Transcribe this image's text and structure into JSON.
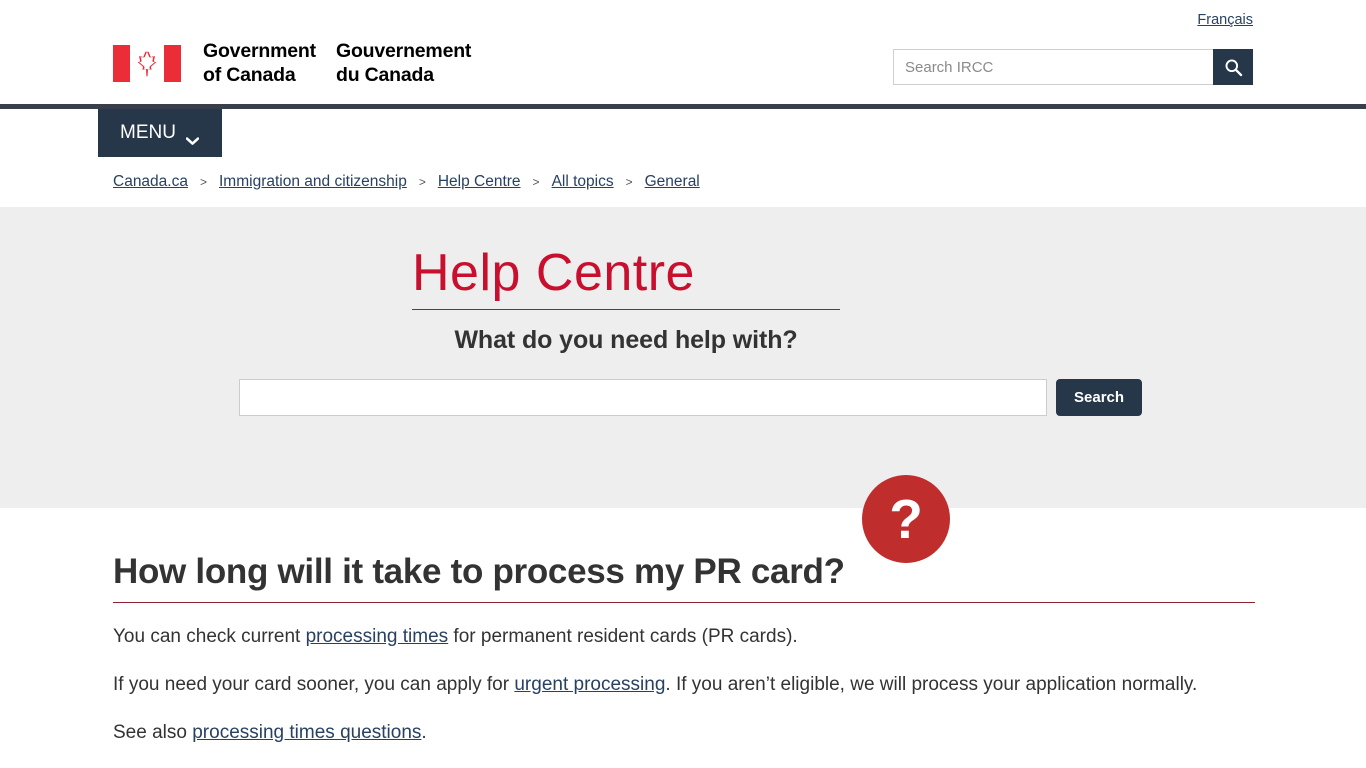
{
  "header": {
    "lang_toggle": "Français",
    "fip": {
      "en_line1": "Government",
      "en_line2": "of Canada",
      "fr_line1": "Gouvernement",
      "fr_line2": "du Canada",
      "flag_icon": "canada-flag-icon"
    },
    "search": {
      "placeholder": "Search IRCC",
      "value": "",
      "button_icon": "magnifier-icon"
    }
  },
  "menu": {
    "label": "MENU",
    "chevron_icon": "chevron-down-icon"
  },
  "breadcrumb": {
    "separator": ">",
    "items": [
      {
        "label": "Canada.ca"
      },
      {
        "label": "Immigration and citizenship"
      },
      {
        "label": "Help Centre"
      },
      {
        "label": "All topics"
      },
      {
        "label": "General"
      }
    ]
  },
  "help_centre": {
    "title": "Help Centre",
    "subtitle": "What do you need help with?",
    "question_mark": "?",
    "question_icon": "question-mark-circle-icon",
    "search": {
      "value": "",
      "placeholder": "",
      "button_label": "Search"
    }
  },
  "article": {
    "title": "How long will it take to process my PR card?",
    "paragraphs": [
      {
        "parts": [
          {
            "type": "text",
            "text": "You can check current "
          },
          {
            "type": "link",
            "text": "processing times"
          },
          {
            "type": "text",
            "text": " for permanent resident cards (PR cards)."
          }
        ]
      },
      {
        "parts": [
          {
            "type": "text",
            "text": "If you need your card sooner, you can apply for "
          },
          {
            "type": "link",
            "text": "urgent processing"
          },
          {
            "type": "text",
            "text": ". If you aren’t eligible, we will process your application normally."
          }
        ]
      },
      {
        "parts": [
          {
            "type": "text",
            "text": "See also "
          },
          {
            "type": "link",
            "text": "processing times questions"
          },
          {
            "type": "text",
            "text": "."
          }
        ]
      }
    ]
  },
  "colors": {
    "nav_dark": "#26374a",
    "header_rule": "#383e4a",
    "brand_red": "#c8102e",
    "qmark_red": "#bf2d2d",
    "link_blue": "#284162",
    "banner_grey": "#eeeeee",
    "title_rule": "#8a2231"
  }
}
